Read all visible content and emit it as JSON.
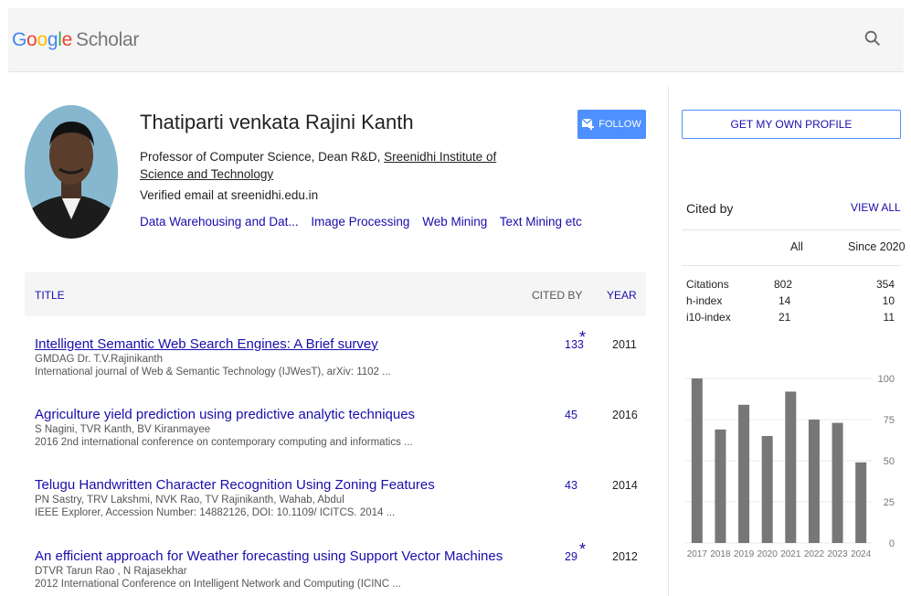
{
  "header": {
    "logo_google": [
      "G",
      "o",
      "o",
      "g",
      "l",
      "e"
    ],
    "logo_scholar": "Scholar",
    "search_icon": "search-icon"
  },
  "profile": {
    "name": "Thatiparti venkata Rajini Kanth",
    "affiliation_prefix": "Professor of Computer Science, Dean R&D, ",
    "affiliation_link": "Sreenidhi Institute of Science and Technology",
    "email": "Verified email at sreenidhi.edu.in",
    "interests": [
      "Data Warehousing and Dat...",
      "Image Processing",
      "Web Mining",
      "Text Mining etc"
    ],
    "follow_label": "FOLLOW"
  },
  "sidebar": {
    "get_profile_label": "GET MY OWN PROFILE",
    "cited_by_label": "Cited by",
    "view_all_label": "VIEW ALL",
    "col_all": "All",
    "col_since": "Since 2020",
    "stats": [
      {
        "label": "Citations",
        "all": "802",
        "since": "354"
      },
      {
        "label": "h-index",
        "all": "14",
        "since": "10"
      },
      {
        "label": "i10-index",
        "all": "21",
        "since": "11"
      }
    ]
  },
  "table": {
    "col_title": "TITLE",
    "col_cited": "CITED BY",
    "col_year": "YEAR",
    "articles": [
      {
        "title": "Intelligent Semantic Web Search Engines: A Brief survey",
        "authors": "GMDAG Dr. T.V.Rajinikanth",
        "venue": "International journal of Web & Semantic Technology (IJWesT), arXiv: 1102 ...",
        "cited": "133",
        "star": "*",
        "year": "2011"
      },
      {
        "title": "Agriculture yield prediction using predictive analytic techniques",
        "authors": "S Nagini, TVR Kanth, BV Kiranmayee",
        "venue": "2016 2nd international conference on contemporary computing and informatics ...",
        "cited": "45",
        "star": "",
        "year": "2016"
      },
      {
        "title": "Telugu Handwritten Character Recognition Using Zoning Features",
        "authors": "PN Sastry, TRV Lakshmi, NVK Rao, TV Rajinikanth, Wahab, Abdul",
        "venue": "IEEE Explorer, Accession Number: 14882126, DOI: 10.1109/ ICITCS. 2014 ...",
        "cited": "43",
        "star": "",
        "year": "2014"
      },
      {
        "title": "An efficient approach for Weather forecasting using Support Vector Machines",
        "authors": "DTVR Tarun Rao , N Rajasekhar",
        "venue": "2012 International Conference on Intelligent Network and Computing (ICINC ...",
        "cited": "29",
        "star": "*",
        "year": "2012"
      }
    ]
  },
  "chart_data": {
    "type": "bar",
    "categories": [
      "2017",
      "2018",
      "2019",
      "2020",
      "2021",
      "2022",
      "2023",
      "2024"
    ],
    "values": [
      100,
      69,
      84,
      65,
      92,
      75,
      73,
      49
    ],
    "ylim": [
      0,
      100
    ],
    "yticks": [
      "0",
      "25",
      "50",
      "75",
      "100"
    ],
    "bar_color": "#777777",
    "grid": true
  }
}
